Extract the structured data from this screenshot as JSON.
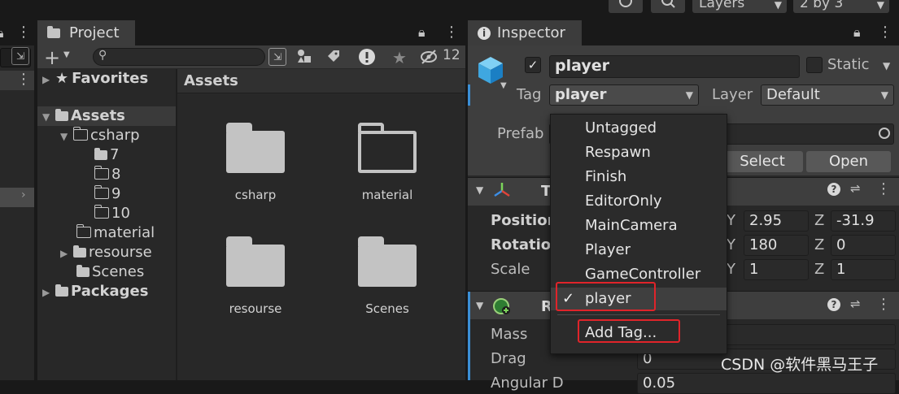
{
  "toolbar": {
    "history_icon": "history-icon",
    "search_icon": "search-icon",
    "layers_label": "Layers",
    "layout_label": "2 by 3"
  },
  "project": {
    "tab_label": "Project",
    "search_placeholder": "",
    "hidden_count": "12",
    "tree": {
      "favorites": "Favorites",
      "assets": "Assets",
      "csharp": "csharp",
      "f7": "7",
      "f8": "8",
      "f9": "9",
      "f10": "10",
      "material": "material",
      "resourse": "resourse",
      "scenes": "Scenes",
      "packages": "Packages"
    },
    "breadcrumb": "Assets",
    "assets": {
      "csharp": "csharp",
      "material": "material",
      "resourse": "resourse",
      "scenes": "Scenes"
    }
  },
  "inspector": {
    "tab_label": "Inspector",
    "object_name": "player",
    "static_label": "Static",
    "tag_label": "Tag",
    "tag_value": "player",
    "layer_label": "Layer",
    "layer_value": "Default",
    "prefab_label": "Prefab",
    "select_label": "Select",
    "open_label": "Open",
    "transform": {
      "title_initial": "T",
      "position_label": "Position",
      "rotation_label": "Rotation",
      "scale_label": "Scale",
      "y_axis": "Y",
      "z_axis": "Z",
      "pos_y": "2.95",
      "pos_z": "-31.9",
      "rot_y": "180",
      "rot_z": "0",
      "scale_y": "1",
      "scale_z": "1"
    },
    "rigidbody": {
      "title_initial": "R",
      "mass_label": "Mass",
      "drag_label": "Drag",
      "drag_value": "0",
      "angular_label": "Angular D",
      "angular_value": "0.05"
    }
  },
  "tag_menu": {
    "items": [
      "Untagged",
      "Respawn",
      "Finish",
      "EditorOnly",
      "MainCamera",
      "Player",
      "GameController",
      "player"
    ],
    "selected_mark": "✓",
    "add_tag": "Add Tag..."
  },
  "watermark": "CSDN @软件黑马王子"
}
